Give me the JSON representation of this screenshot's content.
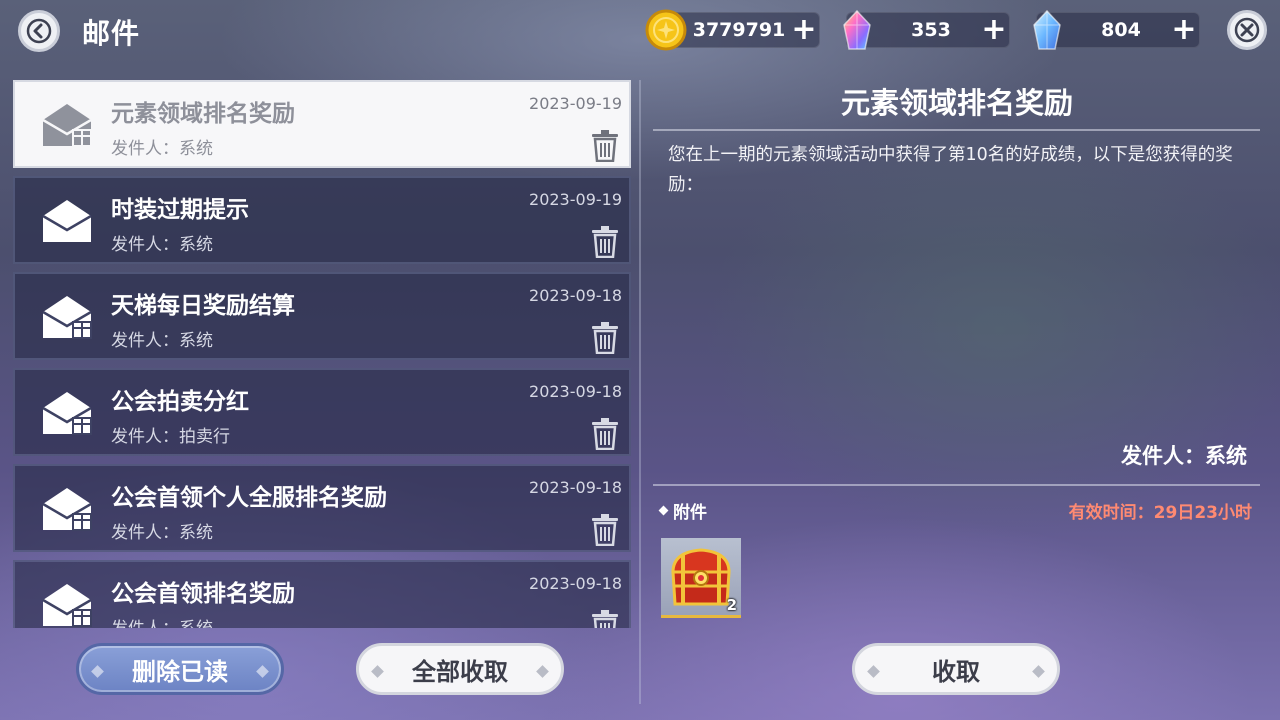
{
  "header": {
    "title": "邮件",
    "back_icon": "back-arrow-icon",
    "close_icon": "close-x-icon"
  },
  "currencies": [
    {
      "name": "gold-coin",
      "value": "3779791",
      "plus": "+",
      "color": "#f2b90f"
    },
    {
      "name": "rainbow-crystal",
      "value": "353",
      "plus": "+",
      "color": "#e06ad8"
    },
    {
      "name": "blue-crystal",
      "value": "804",
      "plus": "+",
      "color": "#69b4f0"
    }
  ],
  "mails": [
    {
      "title": "元素领域排名奖励",
      "sender": "发件人：系统",
      "date": "2023-09-19",
      "selected": true,
      "has_attachment": true
    },
    {
      "title": "时装过期提示",
      "sender": "发件人：系统",
      "date": "2023-09-19",
      "selected": false,
      "has_attachment": false
    },
    {
      "title": "天梯每日奖励结算",
      "sender": "发件人：系统",
      "date": "2023-09-18",
      "selected": false,
      "has_attachment": true
    },
    {
      "title": "公会拍卖分红",
      "sender": "发件人：拍卖行",
      "date": "2023-09-18",
      "selected": false,
      "has_attachment": true
    },
    {
      "title": "公会首领个人全服排名奖励",
      "sender": "发件人：系统",
      "date": "2023-09-18",
      "selected": false,
      "has_attachment": true
    },
    {
      "title": "公会首领排名奖励",
      "sender": "发件人：系统",
      "date": "2023-09-18",
      "selected": false,
      "has_attachment": true
    }
  ],
  "buttons": {
    "delete_read": "删除已读",
    "collect_all": "全部收取",
    "collect": "收取"
  },
  "detail": {
    "title": "元素领域排名奖励",
    "body": "您在上一期的元素领域活动中获得了第10名的好成绩，以下是您获得的奖励：",
    "sender": "发件人：系统",
    "attachment_label": "附件",
    "validity": "有效时间：29日23小时",
    "items": [
      {
        "name": "treasure-chest",
        "count": "2"
      }
    ]
  }
}
